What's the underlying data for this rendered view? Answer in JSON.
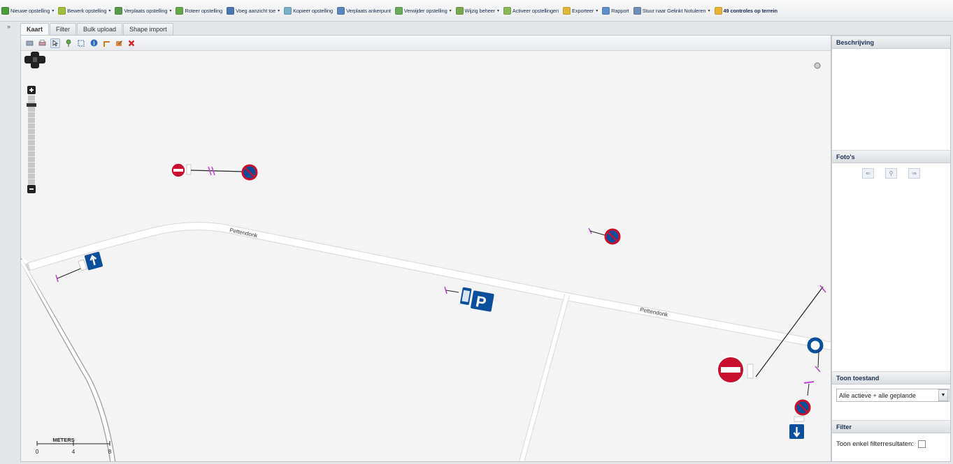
{
  "toolbar": {
    "items": [
      {
        "label": "Nieuwe opstelling",
        "icon": "add-setup-icon",
        "color": "#4a9d3a",
        "dropdown": true
      },
      {
        "label": "Bewerk opstelling",
        "icon": "edit-setup-icon",
        "color": "#9fbf3c",
        "dropdown": true
      },
      {
        "label": "Verplaats opstelling",
        "icon": "move-setup-icon",
        "color": "#5a9a4a",
        "dropdown": true
      },
      {
        "label": "Roteer opstelling",
        "icon": "rotate-setup-icon",
        "color": "#64a84a",
        "dropdown": false
      },
      {
        "label": "Voeg aanzicht toe",
        "icon": "add-view-icon",
        "color": "#4a77b4",
        "dropdown": true
      },
      {
        "label": "Kopieer opstelling",
        "icon": "copy-setup-icon",
        "color": "#7ab0c9",
        "dropdown": false
      },
      {
        "label": "Verplaats ankerpunt",
        "icon": "move-anchor-icon",
        "color": "#5b87c0",
        "dropdown": false
      },
      {
        "label": "Verwijder opstelling",
        "icon": "delete-setup-icon",
        "color": "#6aa85a",
        "dropdown": true
      },
      {
        "label": "Wijzig beheer",
        "icon": "change-management-icon",
        "color": "#79a94c",
        "dropdown": true
      },
      {
        "label": "Activeer opstellingen",
        "icon": "activate-setups-icon",
        "color": "#8ab856",
        "dropdown": false
      },
      {
        "label": "Exporteer",
        "icon": "export-icon",
        "color": "#e0b93a",
        "dropdown": true
      },
      {
        "label": "Rapport",
        "icon": "report-icon",
        "color": "#5f8fc8",
        "dropdown": false
      },
      {
        "label": "Stuur naar Gelinkt Notuleren",
        "icon": "send-icon",
        "color": "#6d8fb6",
        "dropdown": true
      },
      {
        "label": "49 controles op terrein",
        "icon": "pencil-check-icon",
        "color": "#e6b534",
        "dropdown": false,
        "bold": true
      }
    ]
  },
  "collapse_label": "»",
  "tabs": [
    {
      "label": "Kaart",
      "active": true
    },
    {
      "label": "Filter",
      "active": false
    },
    {
      "label": "Bulk upload",
      "active": false
    },
    {
      "label": "Shape import",
      "active": false
    }
  ],
  "map": {
    "street_labels": [
      "Pettendonk",
      "Pettendonk"
    ],
    "scale": {
      "title": "METERS",
      "ticks": [
        "0",
        "4",
        "8"
      ]
    },
    "tools": [
      "layers-icon",
      "print-icon",
      "select-icon",
      "add-point-icon",
      "zoom-box-icon",
      "info-icon",
      "measure-icon",
      "edit-icon",
      "close-icon"
    ],
    "colors": {
      "road": "#ffffff",
      "background": "#f4f4f4",
      "sign_red": "#c8102e",
      "sign_blue": "#0a4f9b",
      "anchor": "#c33fd8"
    }
  },
  "side": {
    "beschrijving": {
      "title": "Beschrijving"
    },
    "fotos": {
      "title": "Foto's",
      "nav": [
        "prev-photo-icon",
        "zoom-photo-icon",
        "next-photo-icon"
      ]
    },
    "toon_toestand": {
      "title": "Toon toestand",
      "selected": "Alle actieve + alle geplande"
    },
    "filter": {
      "title": "Filter",
      "checkbox_label": "Toon enkel filterresultaten:",
      "checked": false
    }
  }
}
